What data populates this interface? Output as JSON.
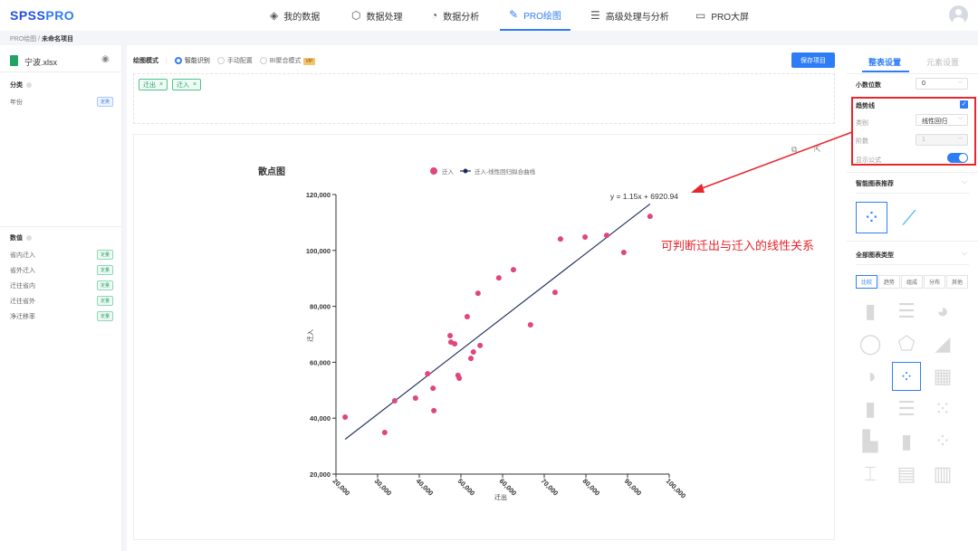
{
  "header": {
    "logo_a": "SPSS",
    "logo_b": "PRO",
    "nav": [
      {
        "label": "我的数据",
        "icon": "layers-icon"
      },
      {
        "label": "数据处理",
        "icon": "cube-icon"
      },
      {
        "label": "数据分析",
        "icon": "pie-icon"
      },
      {
        "label": "PRO绘图",
        "icon": "draw-icon",
        "active": true
      },
      {
        "label": "高级处理与分析",
        "icon": "sliders-icon"
      },
      {
        "label": "PRO大屏",
        "icon": "monitor-icon"
      }
    ]
  },
  "breadcrumb": {
    "parent": "PRO绘图",
    "sep": " / ",
    "current": "未命名项目"
  },
  "left": {
    "file": "宁波.xlsx",
    "cat_title": "分类",
    "cat_items": [
      {
        "label": "年份",
        "badge": "定类"
      }
    ],
    "num_title": "数值",
    "num_items": [
      {
        "label": "省内迁入",
        "badge": "定量"
      },
      {
        "label": "省外迁入",
        "badge": "定量"
      },
      {
        "label": "迁往省内",
        "badge": "定量"
      },
      {
        "label": "迁往省外",
        "badge": "定量"
      },
      {
        "label": "净迁移率",
        "badge": "定量"
      }
    ]
  },
  "toolbar": {
    "mode_label": "绘图模式",
    "modes": [
      "智能识别",
      "手动配置",
      "BI聚合模式"
    ],
    "vip": "VIP",
    "save": "保存项目"
  },
  "tags": [
    "迁出",
    "迁入"
  ],
  "right": {
    "tabs": [
      "整表设置",
      "元素设置"
    ],
    "decimals_label": "小数位数",
    "decimals": "0",
    "trend_label": "趋势线",
    "type_label": "类别",
    "type_value": "线性回归",
    "order_label": "阶数",
    "order_value": "1",
    "formula_label": "显示公式",
    "recommend_label": "智能图表推荐",
    "all_label": "全部图表类型",
    "chart_tabs": [
      "比较",
      "趋势",
      "组成",
      "分布",
      "其他"
    ]
  },
  "annotation": "可判断迁出与迁入的线性关系",
  "colors": {
    "accent": "#2f7df6",
    "point": "#e0457b",
    "line": "#1b2a5c",
    "annotation": "#e8262c"
  },
  "chart_data": {
    "type": "scatter",
    "title": "散点图",
    "xlabel": "迁出",
    "ylabel": "迁入",
    "legend": [
      "迁入",
      "迁入-线性回归拟合曲线"
    ],
    "legend_position": "top",
    "xlim": [
      20000,
      100000
    ],
    "ylim": [
      20000,
      120000
    ],
    "xticks": [
      "20,000",
      "30,000",
      "40,000",
      "50,000",
      "60,000",
      "70,000",
      "80,000",
      "90,000",
      "100,000"
    ],
    "yticks": [
      "20,000",
      "40,000",
      "60,000",
      "80,000",
      "100,000",
      "120,000"
    ],
    "equation": "y = 1.15x + 6920.94",
    "slope": 1.15,
    "intercept": 6920.94,
    "fit_range": [
      22200,
      95400
    ],
    "points": [
      [
        22200,
        40400
      ],
      [
        31700,
        34900
      ],
      [
        34100,
        46200
      ],
      [
        39100,
        47200
      ],
      [
        42000,
        55900
      ],
      [
        43300,
        50700
      ],
      [
        43500,
        42700
      ],
      [
        47400,
        69500
      ],
      [
        47600,
        67200
      ],
      [
        48500,
        66600
      ],
      [
        49300,
        55300
      ],
      [
        49600,
        54300
      ],
      [
        51500,
        76300
      ],
      [
        52400,
        61400
      ],
      [
        53000,
        63700
      ],
      [
        54100,
        84700
      ],
      [
        54600,
        66000
      ],
      [
        59100,
        90200
      ],
      [
        62600,
        93100
      ],
      [
        66700,
        73400
      ],
      [
        72600,
        85000
      ],
      [
        73900,
        104100
      ],
      [
        79800,
        104800
      ],
      [
        85000,
        105400
      ],
      [
        89100,
        99300
      ],
      [
        95400,
        112200
      ]
    ]
  }
}
